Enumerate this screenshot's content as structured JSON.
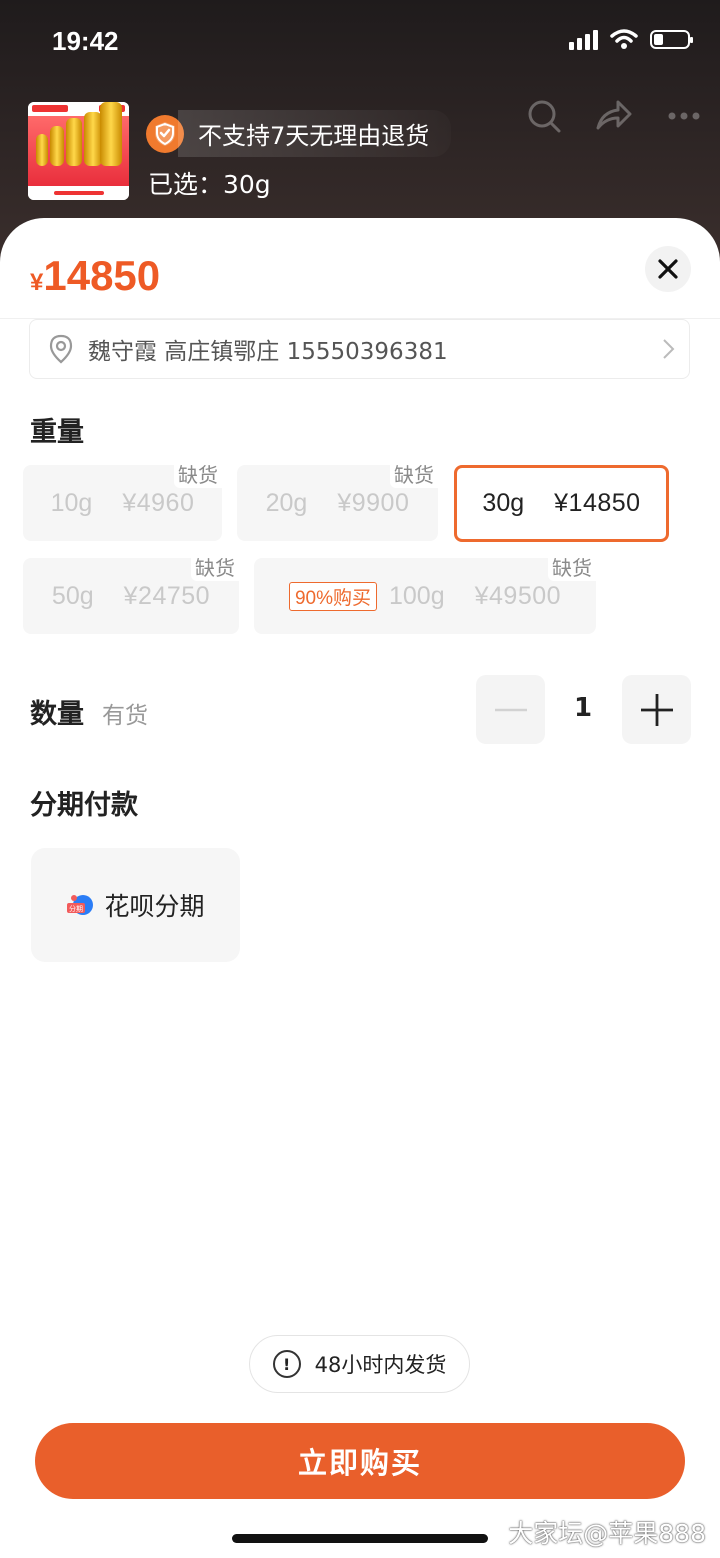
{
  "status_bar": {
    "time": "19:42"
  },
  "product": {
    "return_policy": "不支持7天无理由退货",
    "selected": "已选：30g"
  },
  "sheet": {
    "price_currency": "¥",
    "price": "14850",
    "address": "魏守霞 高庄镇鄂庄 15550396381",
    "weight_title": "重量",
    "weight_options": [
      {
        "weight": "10g",
        "price": "¥4960",
        "badge": "缺货",
        "state": "out_of_stock"
      },
      {
        "weight": "20g",
        "price": "¥9900",
        "badge": "缺货",
        "state": "out_of_stock"
      },
      {
        "weight": "30g",
        "price": "¥14850",
        "badge": "",
        "state": "selected"
      },
      {
        "weight": "50g",
        "price": "¥24750",
        "badge": "缺货",
        "state": "out_of_stock"
      },
      {
        "weight": "100g",
        "price": "¥49500",
        "badge": "缺货",
        "promo": "90%购买",
        "state": "out_of_stock"
      }
    ],
    "quantity_title": "数量",
    "stock_status": "有货",
    "quantity": "1",
    "installment_title": "分期付款",
    "installment_option": "花呗分期",
    "installment_icon_text": "分期",
    "shipping_notice": "48小时内发货",
    "buy_button": "立即购买"
  },
  "watermark": "大家坛@苹果888",
  "colors": {
    "accent": "#ee5a25",
    "button": "#e95f2b"
  }
}
